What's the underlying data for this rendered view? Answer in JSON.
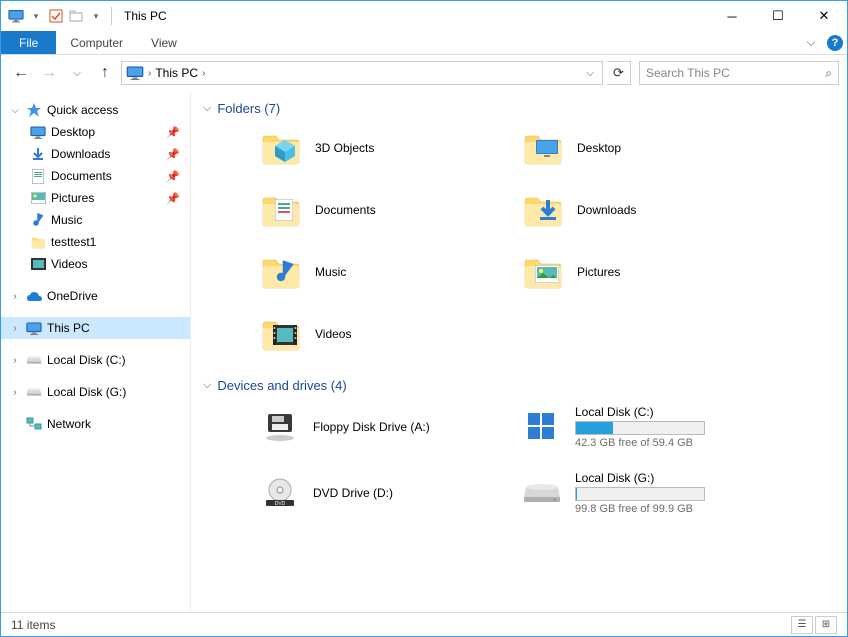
{
  "window": {
    "title": "This PC"
  },
  "ribbon": {
    "file": "File",
    "tabs": [
      "Computer",
      "View"
    ]
  },
  "address": {
    "location": "This PC"
  },
  "search": {
    "placeholder": "Search This PC"
  },
  "sidebar": {
    "quick_access": "Quick access",
    "quick_items": [
      {
        "label": "Desktop",
        "pinned": true
      },
      {
        "label": "Downloads",
        "pinned": true
      },
      {
        "label": "Documents",
        "pinned": true
      },
      {
        "label": "Pictures",
        "pinned": true
      },
      {
        "label": "Music",
        "pinned": false
      },
      {
        "label": "testtest1",
        "pinned": false
      },
      {
        "label": "Videos",
        "pinned": false
      }
    ],
    "onedrive": "OneDrive",
    "this_pc": "This PC",
    "local_c": "Local Disk (C:)",
    "local_g": "Local Disk (G:)",
    "network": "Network"
  },
  "groups": {
    "folders": {
      "title": "Folders (7)",
      "items": [
        "3D Objects",
        "Desktop",
        "Documents",
        "Downloads",
        "Music",
        "Pictures",
        "Videos"
      ]
    },
    "drives": {
      "title": "Devices and drives (4)",
      "items": [
        {
          "label": "Floppy Disk Drive (A:)",
          "type": "floppy"
        },
        {
          "label": "Local Disk (C:)",
          "type": "disk",
          "free": "42.3 GB free of 59.4 GB",
          "used_pct": 29
        },
        {
          "label": "DVD Drive (D:)",
          "type": "dvd"
        },
        {
          "label": "Local Disk (G:)",
          "type": "disk",
          "free": "99.8 GB free of 99.9 GB",
          "used_pct": 1
        }
      ]
    }
  },
  "status": {
    "count": "11 items"
  }
}
